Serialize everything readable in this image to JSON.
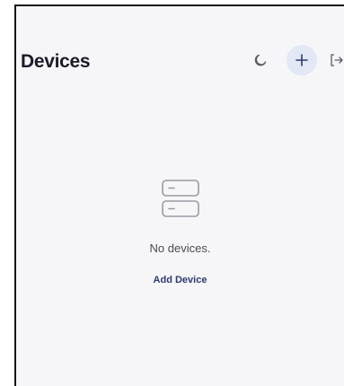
{
  "header": {
    "title": "Devices",
    "icons": {
      "theme": "moon-icon",
      "add": "plus-icon",
      "logout": "logout-icon"
    }
  },
  "empty_state": {
    "icon": "server-icon",
    "message": "No devices.",
    "action_label": "Add Device"
  },
  "colors": {
    "background": "#f6f6f8",
    "accent": "#2f3a6e",
    "add_button_bg": "#e3e8f6"
  }
}
